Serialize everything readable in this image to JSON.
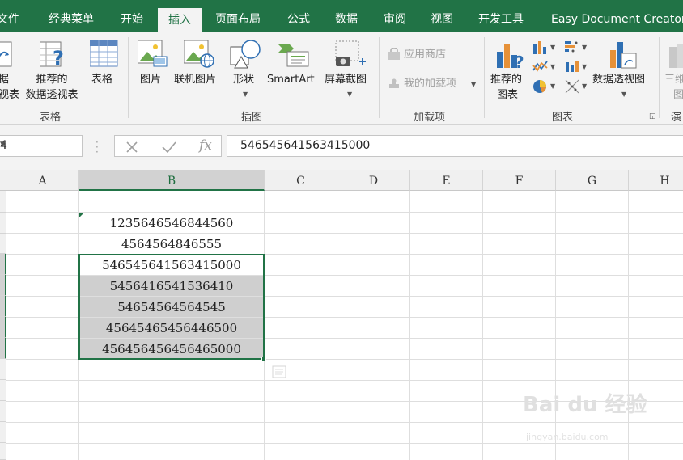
{
  "tabs": [
    "文件",
    "经典菜单",
    "开始",
    "插入",
    "页面布局",
    "公式",
    "数据",
    "审阅",
    "视图",
    "开发工具",
    "Easy Document Creator"
  ],
  "ribbon": {
    "groups": {
      "tables": "表格",
      "illustrations": "插图",
      "addins": "加载项",
      "charts": "图表",
      "tours_partial": "演"
    },
    "tables": {
      "pivot_partial_1": "据",
      "pivot_partial_2": "视表",
      "recommended_pivot_1": "推荐的",
      "recommended_pivot_2": "数据透视表",
      "table": "表格"
    },
    "illustrations": {
      "pictures": "图片",
      "online_pictures": "联机图片",
      "shapes": "形状",
      "smartart": "SmartArt",
      "screenshot": "屏幕截图"
    },
    "addins": {
      "store": "应用商店",
      "my_addins": "我的加载项"
    },
    "charts": {
      "recommended_1": "推荐的",
      "recommended_2": "图表",
      "pivot_chart": "数据透视图",
      "map_partial_1": "三维",
      "map_partial_2": "图"
    }
  },
  "formula_bar": {
    "name_box": "4",
    "formula": "546545641563415000",
    "fx": "fx"
  },
  "columns": [
    "A",
    "B",
    "C",
    "D",
    "E",
    "F",
    "G",
    "H"
  ],
  "cells": [
    "",
    "1235646546844560",
    "4564564846555",
    "546545641563415000",
    "5456416541536410",
    "54654564564545",
    "45645465456446500",
    "456456456456465000"
  ],
  "watermark": {
    "text": "Bai du 经验",
    "sub": "jingyan.baidu.com"
  },
  "colors": {
    "accent": "#217346",
    "selection": "#cfcfcf"
  }
}
